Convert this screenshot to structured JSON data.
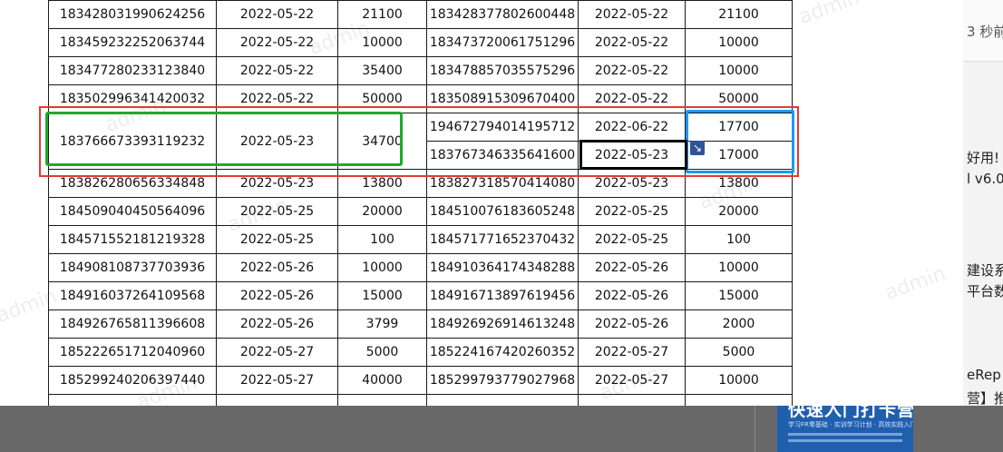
{
  "table": {
    "rows": [
      [
        "183428031990624256",
        "2022-05-22",
        "21100",
        "183428377802600448",
        "2022-05-22",
        "21100"
      ],
      [
        "183459232252063744",
        "2022-05-22",
        "10000",
        "183473720061751296",
        "2022-05-22",
        "10000"
      ],
      [
        "183477280233123840",
        "2022-05-22",
        "35400",
        "183478857035575296",
        "2022-05-22",
        "10000"
      ],
      [
        "183502996341420032",
        "2022-05-22",
        "50000",
        "183508915309670400",
        "2022-05-22",
        "50000"
      ],
      [
        "183766673393119232",
        "2022-05-23",
        "34700",
        "194672794014195712",
        "2022-06-22",
        "17700"
      ],
      [
        "",
        "",
        "",
        "183767346335641600",
        "2022-05-23",
        "17000"
      ],
      [
        "183826280656334848",
        "2022-05-23",
        "13800",
        "183827318570414080",
        "2022-05-23",
        "13800"
      ],
      [
        "184509040450564096",
        "2022-05-25",
        "20000",
        "184510076183605248",
        "2022-05-25",
        "20000"
      ],
      [
        "184571552181219328",
        "2022-05-25",
        "100",
        "184571771652370432",
        "2022-05-25",
        "100"
      ],
      [
        "184908108737703936",
        "2022-05-26",
        "10000",
        "184910364174348288",
        "2022-05-26",
        "10000"
      ],
      [
        "184916037264109568",
        "2022-05-26",
        "15000",
        "184916713897619456",
        "2022-05-26",
        "15000"
      ],
      [
        "184926765811396608",
        "2022-05-26",
        "3799",
        "184926926914613248",
        "2022-05-26",
        "2000"
      ],
      [
        "185222651712040960",
        "2022-05-27",
        "5000",
        "185224167420260352",
        "2022-05-27",
        "5000"
      ],
      [
        "185299240206397440",
        "2022-05-27",
        "40000",
        "185299793779027968",
        "2022-05-27",
        "10000"
      ]
    ]
  },
  "watermark": "admin",
  "right_panel": {
    "time_text": "3 秒前",
    "line1": "好用!",
    "line2": "l v6.0",
    "line3": "建设系",
    "line4": "平台数",
    "line5": "eRep",
    "line6": "营】推"
  },
  "thumbnail": {
    "title": "快速入门打卡营",
    "subtitle": "学习FR零基础 · 实训学习计划 · 高效实践入门"
  },
  "colors": {
    "red_box": "#e53935",
    "green_box": "#22a82c",
    "blue_box": "#2196f3",
    "fill_handle": "#2f5597",
    "bottom_strip": "#686868",
    "thumbnail_bg": "#1f5fae"
  },
  "icons": {
    "fill_handle": "arrow-down-right-icon"
  }
}
